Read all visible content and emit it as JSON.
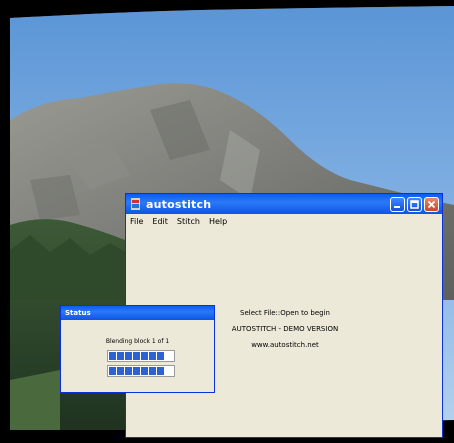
{
  "main_window": {
    "title": "autostitch",
    "menu": [
      "File",
      "Edit",
      "Stitch",
      "Help"
    ],
    "lines": [
      "Select File::Open to begin",
      "AUTOSTITCH - DEMO VERSION",
      "www.autostitch.net"
    ]
  },
  "status_window": {
    "title": "Status",
    "message": "Blending block 1 of 1",
    "progress_bars": [
      0.9,
      0.9
    ]
  }
}
